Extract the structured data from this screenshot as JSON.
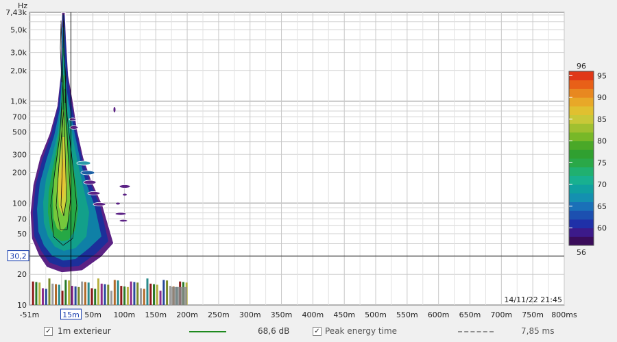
{
  "chart_data": {
    "type": "heatmap",
    "subtype": "spectrogram",
    "yunit": "Hz",
    "xunit": "ms",
    "yscale": "log",
    "yrange": [
      10,
      7430
    ],
    "xrange": [
      -51,
      800
    ],
    "yticks": [
      {
        "v": 7430,
        "label": "7,43k"
      },
      {
        "v": 5000,
        "label": "5,0k"
      },
      {
        "v": 3000,
        "label": "3,0k"
      },
      {
        "v": 2000,
        "label": "2,0k"
      },
      {
        "v": 1000,
        "label": "1,0k"
      },
      {
        "v": 700,
        "label": "700"
      },
      {
        "v": 500,
        "label": "500"
      },
      {
        "v": 300,
        "label": "300"
      },
      {
        "v": 200,
        "label": "200"
      },
      {
        "v": 100,
        "label": "100"
      },
      {
        "v": 70,
        "label": "70"
      },
      {
        "v": 50,
        "label": "50"
      },
      {
        "v": 20,
        "label": "20"
      },
      {
        "v": 10,
        "label": "10"
      }
    ],
    "xticks": [
      {
        "v": -51,
        "label": "-51m"
      },
      {
        "v": 15,
        "label": "15m"
      },
      {
        "v": 50,
        "label": "50m"
      },
      {
        "v": 100,
        "label": "100m"
      },
      {
        "v": 150,
        "label": "150m"
      },
      {
        "v": 200,
        "label": "200m"
      },
      {
        "v": 250,
        "label": "250m"
      },
      {
        "v": 300,
        "label": "300m"
      },
      {
        "v": 350,
        "label": "350m"
      },
      {
        "v": 400,
        "label": "400m"
      },
      {
        "v": 450,
        "label": "450m"
      },
      {
        "v": 500,
        "label": "500m"
      },
      {
        "v": 550,
        "label": "550m"
      },
      {
        "v": 600,
        "label": "600m"
      },
      {
        "v": 650,
        "label": "650m"
      },
      {
        "v": 700,
        "label": "700m"
      },
      {
        "v": 750,
        "label": "750m"
      },
      {
        "v": 800,
        "label": "800ms"
      }
    ],
    "cursor_time": 15,
    "cursor_freq": 30.2,
    "cursor_freq_label": "30,2",
    "timestamp": "14/11/22 21:45",
    "colorbar": {
      "min": 56,
      "max": 96,
      "min_label": "56",
      "max_label": "96",
      "ticks": [
        95,
        90,
        85,
        80,
        75,
        70,
        65,
        60
      ]
    },
    "series": [
      {
        "name": "1m exterieur",
        "type": "spectrogram"
      },
      {
        "name": "Peak energy time",
        "type": "line"
      }
    ]
  },
  "legend": {
    "series1_name": "1m exterieur",
    "series1_value": "68,6 dB",
    "series1_color": "#1e8a1e",
    "series2_name": "Peak energy time",
    "series2_value": "7,85 ms",
    "series2_color": "#909090"
  }
}
